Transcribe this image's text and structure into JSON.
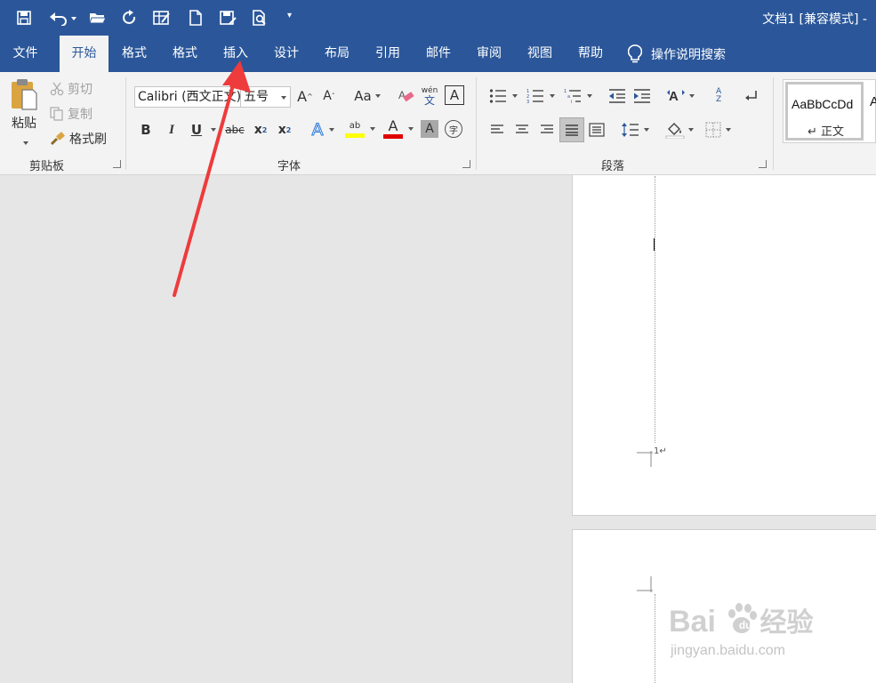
{
  "window": {
    "title": "文档1 [兼容模式] -"
  },
  "quick_access": {
    "buttons": [
      "save-icon",
      "undo-icon",
      "open-folder-icon",
      "redo-icon",
      "table-icon",
      "new-document-icon",
      "save-as-icon",
      "print-preview-icon"
    ],
    "customize": "▾"
  },
  "tabs": [
    {
      "label": "文件"
    },
    {
      "label": "开始"
    },
    {
      "label": "格式"
    },
    {
      "label": "格式"
    },
    {
      "label": "插入"
    },
    {
      "label": "设计"
    },
    {
      "label": "布局"
    },
    {
      "label": "引用"
    },
    {
      "label": "邮件"
    },
    {
      "label": "审阅"
    },
    {
      "label": "视图"
    },
    {
      "label": "帮助"
    }
  ],
  "tell_me": {
    "label": "操作说明搜索"
  },
  "clipboard": {
    "paste": "粘贴",
    "cut": "剪切",
    "copy": "复制",
    "format_painter": "格式刷",
    "group_label": "剪贴板"
  },
  "font": {
    "name": "Calibri (西文正文)",
    "size": "五号",
    "grow": "A",
    "shrink": "A",
    "change_case": "Aa",
    "phonetic_top": "wén",
    "phonetic_bottom": "文",
    "char_border": "A",
    "bold": "B",
    "italic": "I",
    "underline": "U",
    "strike": "abc",
    "subscript": "x",
    "subscript_mark": "2",
    "superscript": "x",
    "superscript_mark": "2",
    "text_effect": "A",
    "highlight": "ab",
    "font_color": "A",
    "char_shading": "A",
    "enclose": "字",
    "group_label": "字体"
  },
  "paragraph": {
    "group_label": "段落",
    "sort": "A Z"
  },
  "styles": {
    "sample": "AaBbCcDd",
    "name": "正文",
    "next_sample": "A"
  },
  "colors": {
    "accent": "#2b579a",
    "highlight": "#ffff00",
    "font_color": "#e00000",
    "arrow": "#ee3b3b"
  },
  "document": {
    "page_number": "1"
  },
  "watermark": {
    "brand_left": "Bai",
    "brand_paw": "du",
    "brand_right": "经验",
    "url": "jingyan.baidu.com"
  }
}
